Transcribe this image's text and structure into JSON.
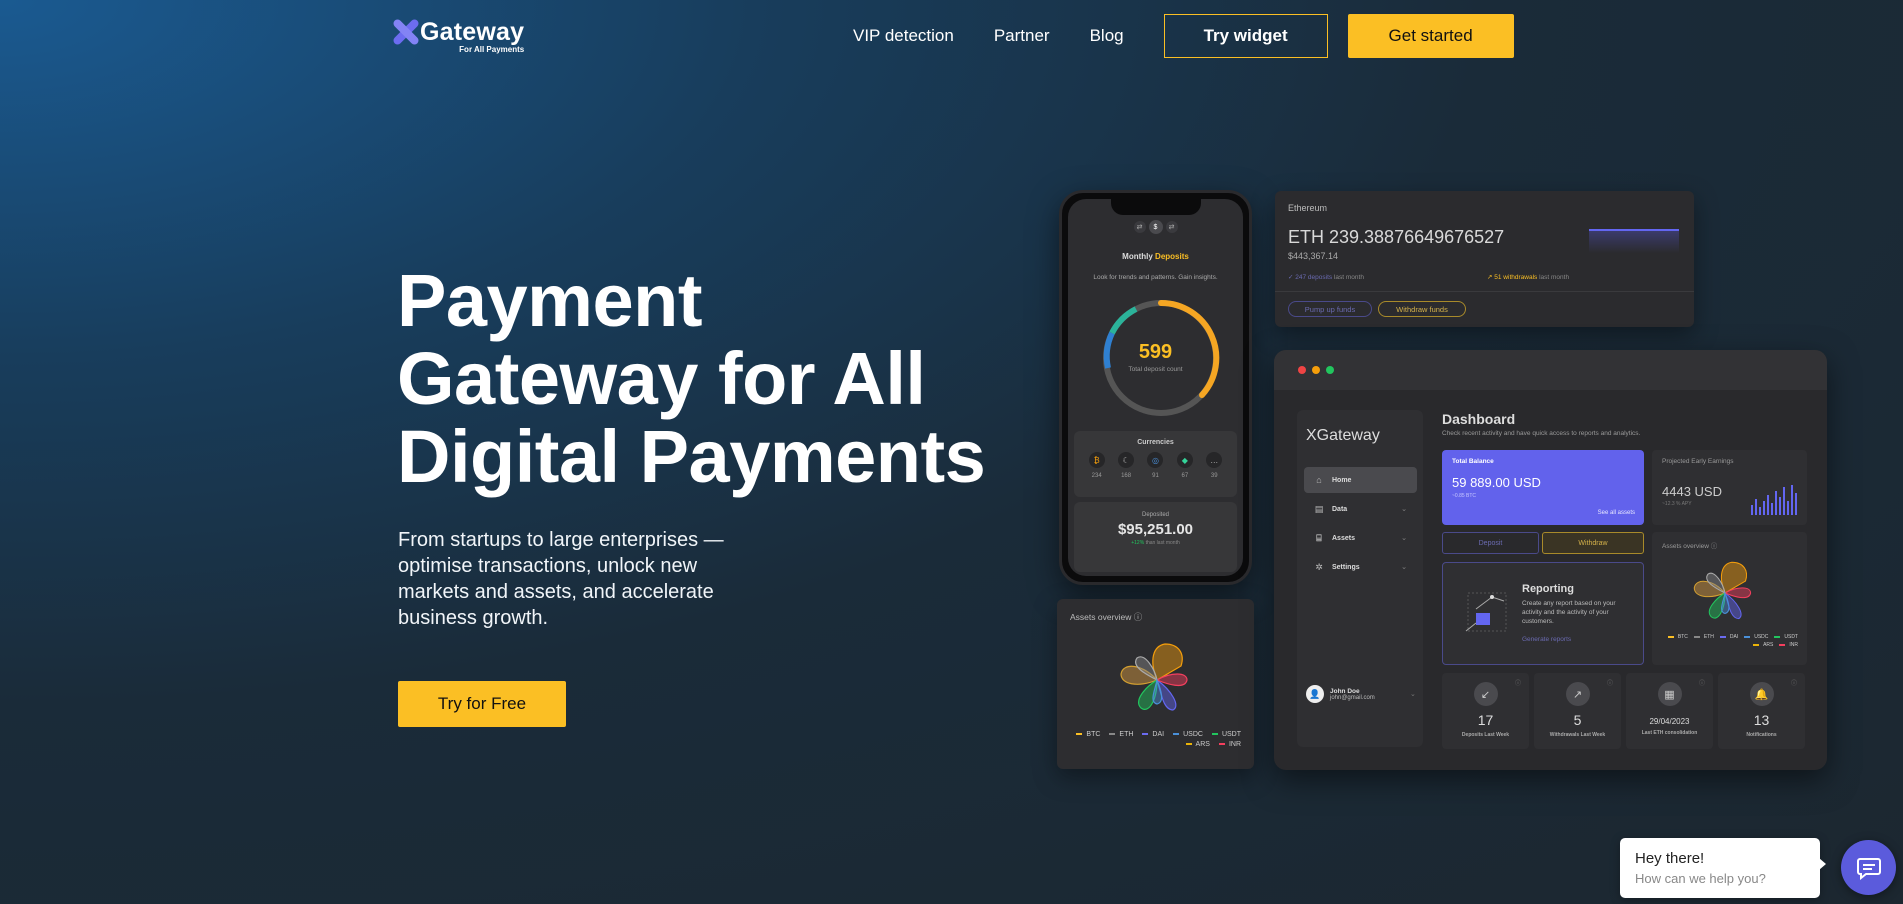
{
  "brand": {
    "name": "Gateway",
    "tagline": "For All Payments"
  },
  "nav": {
    "links": [
      "VIP detection",
      "Partner",
      "Blog"
    ],
    "try_widget": "Try widget",
    "get_started": "Get started"
  },
  "hero": {
    "title_lines": [
      "Payment",
      "Gateway for All",
      "Digital Payments"
    ],
    "subtitle": "From startups to large enterprises — optimise transactions, unlock new markets and assets, and accelerate business growth.",
    "cta": "Try for Free"
  },
  "phone": {
    "pill_left": "⇄",
    "pill_mid": "$",
    "pill_right": "⇄",
    "title_prefix": "Monthly ",
    "title_highlight": "Deposits",
    "desc": "Look for trends and patterns. Gain insights.",
    "deposit_count": "599",
    "deposit_count_label": "Total deposit count",
    "currencies_title": "Currencies",
    "currencies": [
      {
        "icon": "bitcoin-icon",
        "glyph": "₿",
        "color": "#f59e0b",
        "count": "234"
      },
      {
        "icon": "moon-icon",
        "glyph": "☾",
        "color": "#bbbbbb",
        "count": "168"
      },
      {
        "icon": "coin-icon",
        "glyph": "◎",
        "color": "#4a90d9",
        "count": "91"
      },
      {
        "icon": "gem-icon",
        "glyph": "◆",
        "color": "#34d399",
        "count": "67"
      },
      {
        "icon": "more-icon",
        "glyph": "…",
        "color": "#bbbbbb",
        "count": "39"
      }
    ],
    "deposited_label": "Deposited",
    "deposited_value": "$95,251.00",
    "deposited_change": "+12%",
    "deposited_sub": "than last month"
  },
  "assets_card": {
    "title": "Assets overview",
    "legend": [
      "BTC",
      "ETH",
      "DAI",
      "USDC",
      "USDT",
      "ARS",
      "INR"
    ]
  },
  "eth_card": {
    "name": "Ethereum",
    "value": "ETH 239.38876649676527",
    "usd": "$443,367.14",
    "deposits": "247 deposits",
    "deposits_period": "last month",
    "withdrawals": "51 withdrawals",
    "withdrawals_period": "last month",
    "pump_btn": "Pump up funds",
    "withdraw_btn": "Withdraw funds"
  },
  "dashboard": {
    "brand": "XGateway",
    "menu": [
      {
        "label": "Home",
        "icon": "home-icon",
        "glyph": "⌂"
      },
      {
        "label": "Data",
        "icon": "data-icon",
        "glyph": "▤"
      },
      {
        "label": "Assets",
        "icon": "bank-icon",
        "glyph": "⌸"
      },
      {
        "label": "Settings",
        "icon": "gear-icon",
        "glyph": "✲"
      }
    ],
    "user_name": "John Doe",
    "user_email": "john@gmail.com",
    "title": "Dashboard",
    "subtitle": "Check recent activity and have quick access to reports and analytics.",
    "balance_label": "Total Balance",
    "balance_value": "59 889.00 USD",
    "balance_sub": "~0.85 BTC",
    "see_all": "See all assets",
    "projected_label": "Projected Early Earnings",
    "projected_value": "4443 USD",
    "projected_sub": "~12.3 % APY",
    "deposit_btn": "Deposit",
    "withdraw_btn": "Withdraw",
    "reporting_title": "Reporting",
    "reporting_desc": "Create any report based on your activity and the activity of your customers.",
    "reporting_link": "Generate reports",
    "overview_label": "Assets overview",
    "overview_legend": [
      "BTC",
      "ETH",
      "DAI",
      "USDC",
      "USDT",
      "ARS",
      "INR"
    ],
    "stats": [
      {
        "icon": "arrow-down-left-icon",
        "glyph": "↙",
        "value": "17",
        "label": "Deposits Last Week"
      },
      {
        "icon": "arrow-up-right-icon",
        "glyph": "↗",
        "value": "5",
        "label": "Withdrawals Last Week"
      },
      {
        "icon": "calendar-icon",
        "glyph": "▦",
        "value": "29/04/2023",
        "label": "Last ETH consolidation"
      },
      {
        "icon": "bell-icon",
        "glyph": "🔔",
        "value": "13",
        "label": "Notifications"
      }
    ]
  },
  "chat": {
    "greeting": "Hey there!",
    "prompt": "How can we help you?"
  }
}
